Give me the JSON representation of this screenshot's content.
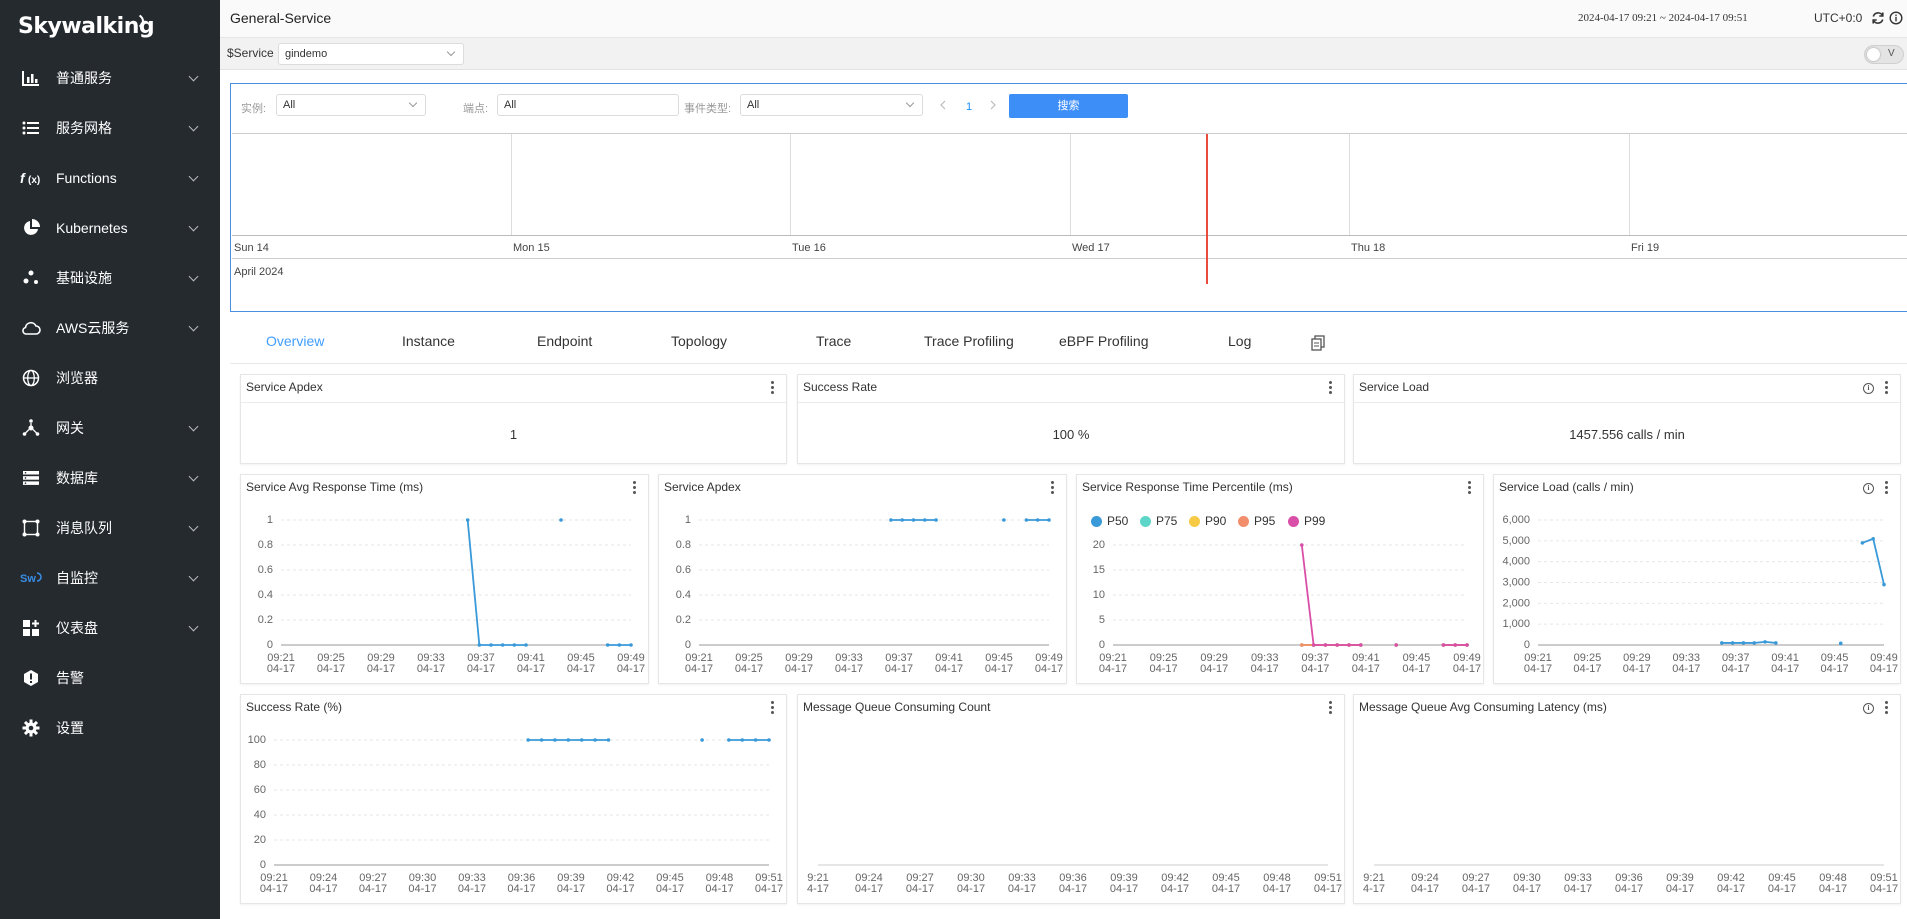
{
  "sidebar": {
    "logo": "Skywalking",
    "items": [
      {
        "label": "普通服务",
        "icon": "bar-chart-icon",
        "chevron": true
      },
      {
        "label": "服务网格",
        "icon": "grid-list-icon",
        "chevron": true
      },
      {
        "label": "Functions",
        "icon": "function-icon",
        "chevron": true
      },
      {
        "label": "Kubernetes",
        "icon": "pie-icon",
        "chevron": true
      },
      {
        "label": "基础设施",
        "icon": "dots-cluster-icon",
        "chevron": true
      },
      {
        "label": "AWS云服务",
        "icon": "cloud-icon",
        "chevron": true
      },
      {
        "label": "浏览器",
        "icon": "globe-icon",
        "chevron": false
      },
      {
        "label": "网关",
        "icon": "gateway-icon",
        "chevron": true
      },
      {
        "label": "数据库",
        "icon": "database-icon",
        "chevron": true
      },
      {
        "label": "消息队列",
        "icon": "queue-icon",
        "chevron": true
      },
      {
        "label": "自监控",
        "icon": "sw-self-icon",
        "chevron": true
      },
      {
        "label": "仪表盘",
        "icon": "dashboard-icon",
        "chevron": true
      },
      {
        "label": "告警",
        "icon": "alarm-icon",
        "chevron": false
      },
      {
        "label": "设置",
        "icon": "gear-icon",
        "chevron": false
      }
    ]
  },
  "header": {
    "title": "General-Service",
    "time_range": "2024-04-17 09:21 ~ 2024-04-17 09:51",
    "timezone": "UTC+0:0"
  },
  "service_bar": {
    "label": "$Service",
    "value": "gindemo",
    "toggle_label": "V"
  },
  "events": {
    "filters": [
      {
        "label": "实例:",
        "value": "All"
      },
      {
        "label": "端点:",
        "value": "All"
      },
      {
        "label": "事件类型:",
        "value": "All"
      }
    ],
    "page": "1",
    "search_label": "搜索",
    "timeline_days": [
      "Sun 14",
      "Mon 15",
      "Tue 16",
      "Wed 17",
      "Thu 18",
      "Fri 19"
    ],
    "timeline_month": "April 2024"
  },
  "tabs": [
    "Overview",
    "Instance",
    "Endpoint",
    "Topology",
    "Trace",
    "Trace Profiling",
    "eBPF Profiling",
    "Log"
  ],
  "active_tab": "Overview",
  "cards": [
    {
      "title": "Service Apdex",
      "value": "1"
    },
    {
      "title": "Success Rate",
      "value": "100 %"
    },
    {
      "title": "Service Load",
      "value": "1457.556 calls / min"
    }
  ],
  "chart_data": [
    {
      "type": "line",
      "title": "Service Avg Response Time (ms)",
      "x": [
        "09:21",
        "09:22",
        "09:23",
        "09:24",
        "09:25",
        "09:26",
        "09:27",
        "09:28",
        "09:29",
        "09:30",
        "09:31",
        "09:32",
        "09:33",
        "09:34",
        "09:35",
        "09:36",
        "09:37",
        "09:38",
        "09:39",
        "09:40",
        "09:41",
        "09:42",
        "09:43",
        "09:44",
        "09:45",
        "09:46",
        "09:47",
        "09:48",
        "09:49",
        "09:50",
        "09:51"
      ],
      "tick_labels": [
        "09:21",
        "09:25",
        "09:29",
        "09:33",
        "09:37",
        "09:41",
        "09:45",
        "09:49"
      ],
      "tick_date": "04-17",
      "ylim": [
        0,
        1
      ],
      "yticks": [
        "0",
        "0.2",
        "0.4",
        "0.6",
        "0.8",
        "1"
      ],
      "series": [
        {
          "color": "#3a9ad9",
          "values": [
            null,
            null,
            null,
            null,
            null,
            null,
            null,
            null,
            null,
            null,
            null,
            null,
            null,
            null,
            null,
            null,
            1,
            0,
            0,
            0,
            0,
            0,
            null,
            null,
            1,
            null,
            null,
            null,
            0,
            0,
            0
          ]
        }
      ]
    },
    {
      "type": "line",
      "title": "Service Apdex",
      "x": [
        "09:21",
        "09:22",
        "09:23",
        "09:24",
        "09:25",
        "09:26",
        "09:27",
        "09:28",
        "09:29",
        "09:30",
        "09:31",
        "09:32",
        "09:33",
        "09:34",
        "09:35",
        "09:36",
        "09:37",
        "09:38",
        "09:39",
        "09:40",
        "09:41",
        "09:42",
        "09:43",
        "09:44",
        "09:45",
        "09:46",
        "09:47",
        "09:48",
        "09:49",
        "09:50",
        "09:51"
      ],
      "tick_labels": [
        "09:21",
        "09:25",
        "09:29",
        "09:33",
        "09:37",
        "09:41",
        "09:45",
        "09:49"
      ],
      "tick_date": "04-17",
      "ylim": [
        0,
        1
      ],
      "yticks": [
        "0",
        "0.2",
        "0.4",
        "0.6",
        "0.8",
        "1"
      ],
      "series": [
        {
          "color": "#3a9ad9",
          "values": [
            null,
            null,
            null,
            null,
            null,
            null,
            null,
            null,
            null,
            null,
            null,
            null,
            null,
            null,
            null,
            null,
            null,
            1,
            1,
            1,
            1,
            1,
            null,
            null,
            null,
            null,
            null,
            1,
            null,
            1,
            1,
            1
          ]
        }
      ]
    },
    {
      "type": "line",
      "title": "Service Response Time Percentile (ms)",
      "x": [
        "09:21",
        "09:22",
        "09:23",
        "09:24",
        "09:25",
        "09:26",
        "09:27",
        "09:28",
        "09:29",
        "09:30",
        "09:31",
        "09:32",
        "09:33",
        "09:34",
        "09:35",
        "09:36",
        "09:37",
        "09:38",
        "09:39",
        "09:40",
        "09:41",
        "09:42",
        "09:43",
        "09:44",
        "09:45",
        "09:46",
        "09:47",
        "09:48",
        "09:49",
        "09:50",
        "09:51"
      ],
      "tick_labels": [
        "09:21",
        "09:25",
        "09:29",
        "09:33",
        "09:37",
        "09:41",
        "09:45",
        "09:49"
      ],
      "tick_date": "04-17",
      "ylim": [
        0,
        20
      ],
      "yticks": [
        "0",
        "5",
        "10",
        "15",
        "20"
      ],
      "series": [
        {
          "name": "P50",
          "color": "#3a9ad9",
          "values": [
            null,
            null,
            null,
            null,
            null,
            null,
            null,
            null,
            null,
            null,
            null,
            null,
            null,
            null,
            null,
            null,
            0,
            0,
            0,
            0,
            0,
            0,
            null,
            null,
            0,
            null,
            null,
            null,
            0,
            0,
            0
          ]
        },
        {
          "name": "P75",
          "color": "#5dd6c9",
          "values": [
            null,
            null,
            null,
            null,
            null,
            null,
            null,
            null,
            null,
            null,
            null,
            null,
            null,
            null,
            null,
            null,
            0,
            0,
            0,
            0,
            0,
            0,
            null,
            null,
            0,
            null,
            null,
            null,
            0,
            0,
            0
          ]
        },
        {
          "name": "P90",
          "color": "#f7ca45",
          "values": [
            null,
            null,
            null,
            null,
            null,
            null,
            null,
            null,
            null,
            null,
            null,
            null,
            null,
            null,
            null,
            null,
            0,
            0,
            0,
            0,
            0,
            0,
            null,
            null,
            0,
            null,
            null,
            null,
            0,
            0,
            0
          ]
        },
        {
          "name": "P95",
          "color": "#f28e6b",
          "values": [
            null,
            null,
            null,
            null,
            null,
            null,
            null,
            null,
            null,
            null,
            null,
            null,
            null,
            null,
            null,
            null,
            0,
            0,
            0,
            0,
            0,
            0,
            null,
            null,
            0,
            null,
            null,
            null,
            0,
            0,
            0
          ]
        },
        {
          "name": "P99",
          "color": "#d94fa7",
          "values": [
            null,
            null,
            null,
            null,
            null,
            null,
            null,
            null,
            null,
            null,
            null,
            null,
            null,
            null,
            null,
            null,
            20,
            0,
            0,
            0,
            0,
            0,
            null,
            null,
            0,
            null,
            null,
            null,
            0,
            0,
            0
          ]
        }
      ]
    },
    {
      "type": "line",
      "title": "Service Load (calls / min)",
      "x": [
        "09:21",
        "09:22",
        "09:23",
        "09:24",
        "09:25",
        "09:26",
        "09:27",
        "09:28",
        "09:29",
        "09:30",
        "09:31",
        "09:32",
        "09:33",
        "09:34",
        "09:35",
        "09:36",
        "09:37",
        "09:38",
        "09:39",
        "09:40",
        "09:41",
        "09:42",
        "09:43",
        "09:44",
        "09:45",
        "09:46",
        "09:47",
        "09:48",
        "09:49",
        "09:50",
        "09:51"
      ],
      "tick_labels": [
        "09:21",
        "09:25",
        "09:29",
        "09:33",
        "09:37",
        "09:41",
        "09:45",
        "09:49"
      ],
      "tick_date": "04-17",
      "ylim": [
        0,
        6000
      ],
      "yticks": [
        "0",
        "1,000",
        "2,000",
        "3,000",
        "4,000",
        "5,000",
        "6,000"
      ],
      "series": [
        {
          "color": "#3a9ad9",
          "values": [
            null,
            null,
            null,
            null,
            null,
            null,
            null,
            null,
            null,
            null,
            null,
            null,
            null,
            null,
            null,
            null,
            null,
            100,
            100,
            100,
            100,
            150,
            100,
            null,
            null,
            null,
            null,
            null,
            80,
            null,
            4900,
            5100,
            2900
          ]
        }
      ]
    },
    {
      "type": "line",
      "title": "Success Rate (%)",
      "x": [
        "09:21",
        "09:22",
        "09:23",
        "09:24",
        "09:25",
        "09:26",
        "09:27",
        "09:28",
        "09:29",
        "09:30",
        "09:31",
        "09:32",
        "09:33",
        "09:34",
        "09:35",
        "09:36",
        "09:37",
        "09:38",
        "09:39",
        "09:40",
        "09:41",
        "09:42",
        "09:43",
        "09:44",
        "09:45",
        "09:46",
        "09:47",
        "09:48",
        "09:49",
        "09:50",
        "09:51"
      ],
      "tick_labels": [
        "09:21",
        "09:24",
        "09:27",
        "09:30",
        "09:33",
        "09:36",
        "09:39",
        "09:42",
        "09:45",
        "09:48",
        "09:51"
      ],
      "tick_date": "04-17",
      "ylim": [
        0,
        100
      ],
      "yticks": [
        "0",
        "20",
        "40",
        "60",
        "80",
        "100"
      ],
      "series": [
        {
          "color": "#3a9ad9",
          "values": [
            null,
            null,
            null,
            null,
            null,
            null,
            null,
            null,
            null,
            null,
            null,
            null,
            null,
            null,
            null,
            null,
            null,
            null,
            null,
            100,
            100,
            100,
            100,
            100,
            100,
            100,
            null,
            null,
            null,
            null,
            null,
            null,
            100,
            null,
            100,
            100,
            100,
            100
          ]
        }
      ]
    },
    {
      "type": "line",
      "title": "Message Queue Consuming Count",
      "tick_labels": [
        "9:21",
        "09:24",
        "09:27",
        "09:30",
        "09:33",
        "09:36",
        "09:39",
        "09:42",
        "09:45",
        "09:48",
        "09:51"
      ],
      "tick_dates": [
        "4-17",
        "04-17",
        "04-17",
        "04-17",
        "04-17",
        "04-17",
        "04-17",
        "04-17",
        "04-17",
        "04-17",
        "04-17"
      ],
      "series": []
    },
    {
      "type": "line",
      "title": "Message Queue Avg Consuming Latency (ms)",
      "tick_labels": [
        "9:21",
        "09:24",
        "09:27",
        "09:30",
        "09:33",
        "09:36",
        "09:39",
        "09:42",
        "09:45",
        "09:48",
        "09:51"
      ],
      "tick_dates": [
        "4-17",
        "04-17",
        "04-17",
        "04-17",
        "04-17",
        "04-17",
        "04-17",
        "04-17",
        "04-17",
        "04-17",
        "04-17"
      ],
      "series": []
    }
  ]
}
